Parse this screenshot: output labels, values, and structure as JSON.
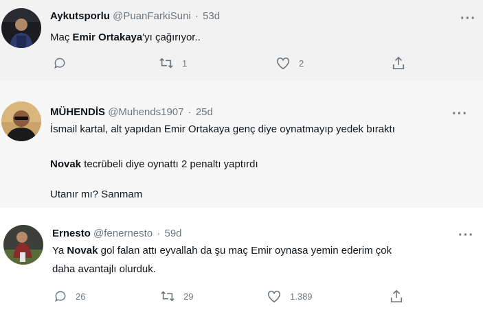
{
  "tweets": [
    {
      "name": "Aykutsporlu",
      "handle": "@PuanFarkiSuni",
      "time": "53d",
      "text_pre": "Maç ",
      "text_bold": "Emir Ortakaya",
      "text_post": "'yı çağırıyor..",
      "reply_count": "",
      "retweet_count": "1",
      "like_count": "2"
    },
    {
      "name": "MÜHENDİS",
      "handle": "@Muhends1907",
      "time": "25d",
      "line1": "İsmail kartal, alt yapıdan Emir Ortakaya genç diye oynatmayıp yedek bıraktı",
      "line2_bold": "Novak",
      "line2_rest": " tecrübeli diye oynattı 2 penaltı yaptırdı",
      "line3": "Utanır mı? Sanmam"
    },
    {
      "name": "Ernesto",
      "handle": "@fenernesto",
      "time": "59d",
      "text_pre": "Ya ",
      "text_bold": "Novak",
      "text_post": " gol falan attı eyvallah da şu maç Emir oynasa yemin ederim çok",
      "text_line2": "daha avantajlı olurduk.",
      "reply_count": "26",
      "retweet_count": "29",
      "like_count": "1.389"
    }
  ],
  "ui": {
    "separator": "·",
    "more": "···"
  },
  "icons": [
    "reply-icon",
    "retweet-icon",
    "like-icon",
    "share-icon",
    "more-icon"
  ],
  "colors": {
    "muted": "#6e767d",
    "text": "#0f1419"
  }
}
